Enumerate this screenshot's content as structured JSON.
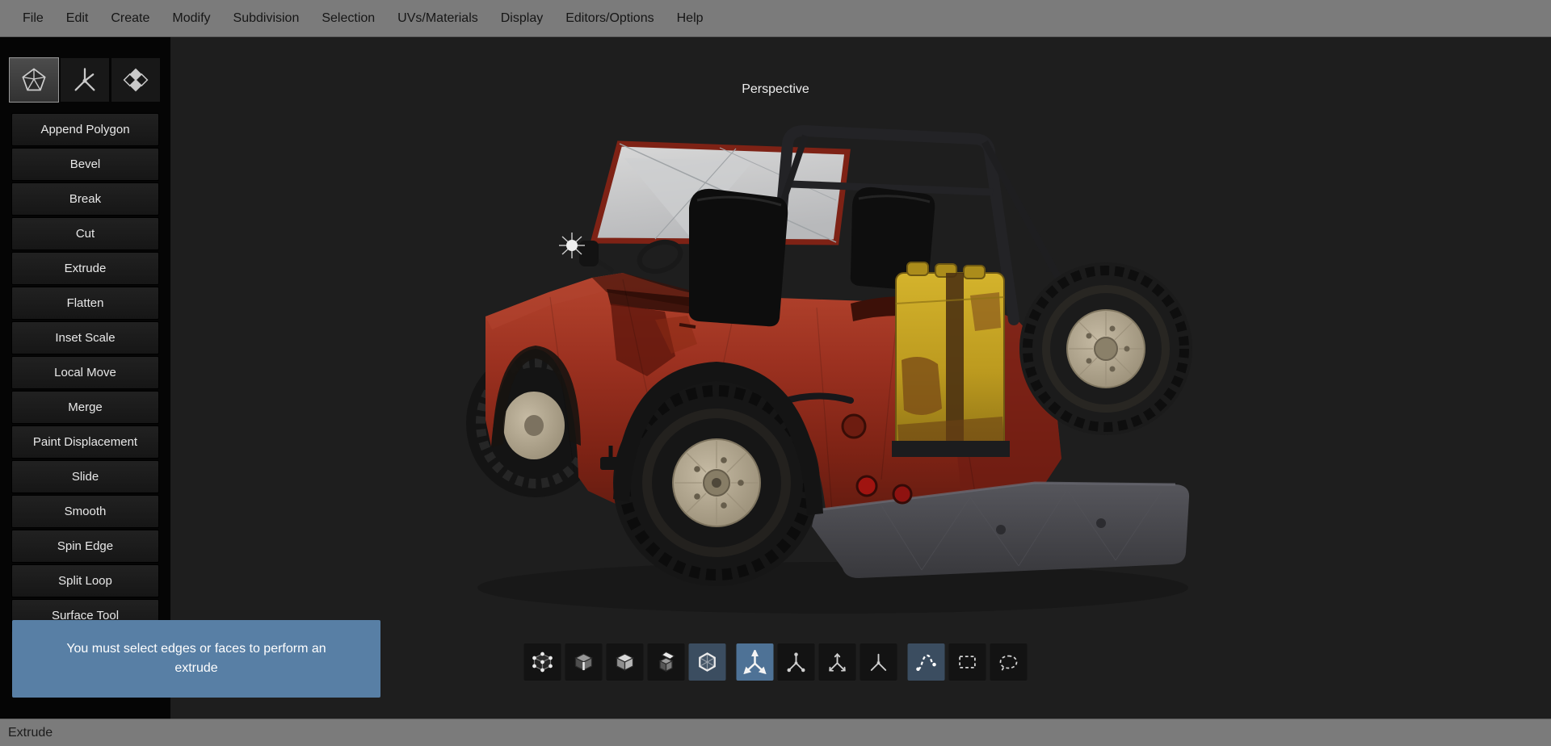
{
  "colors": {
    "menu_bar_bg": "#7b7b7b",
    "viewport_bg": "#1e1e1e",
    "panel_bg": "#050505",
    "tool_button_bg": "#1b1b1b",
    "notification_bg": "#587fa5",
    "selected_tool_bg": "#4e7296",
    "status_bar_bg": "#7b7b7b",
    "jeep_body_red": "#9c3120",
    "jerry_can_yellow": "#c2a11e"
  },
  "menu_bar": {
    "items": [
      "File",
      "Edit",
      "Create",
      "Modify",
      "Subdivision",
      "Selection",
      "UVs/Materials",
      "Display",
      "Editors/Options",
      "Help"
    ]
  },
  "left_panel": {
    "mode_tabs": [
      {
        "name": "polygon-tools-tab",
        "icon": "wireframe-gem-icon",
        "selected": true
      },
      {
        "name": "topology-tools-tab",
        "icon": "axis-star-icon",
        "selected": false
      },
      {
        "name": "uv-tools-tab",
        "icon": "checker-diamond-icon",
        "selected": false
      }
    ],
    "tools": [
      "Append Polygon",
      "Bevel",
      "Break",
      "Cut",
      "Extrude",
      "Flatten",
      "Inset Scale",
      "Local Move",
      "Merge",
      "Paint Displacement",
      "Slide",
      "Smooth",
      "Spin Edge",
      "Split Loop",
      "Surface Tool"
    ]
  },
  "notification": {
    "message": "You must select edges or faces to perform an extrude"
  },
  "viewport": {
    "label": "Perspective"
  },
  "bottom_toolbar": {
    "groups": [
      {
        "icons": [
          {
            "name": "vertex-select-mode",
            "selected": false
          },
          {
            "name": "edge-select-mode",
            "selected": false
          },
          {
            "name": "face-select-mode",
            "selected": false
          },
          {
            "name": "object-select-mode",
            "selected": false
          },
          {
            "name": "polygon-select-mode",
            "selected": true
          }
        ]
      },
      {
        "icons": [
          {
            "name": "move-tool",
            "selected": true
          },
          {
            "name": "axis-dots-tool",
            "selected": false
          },
          {
            "name": "axis-arrows-tool",
            "selected": false
          },
          {
            "name": "axis-pivot-tool",
            "selected": false
          }
        ]
      },
      {
        "icons": [
          {
            "name": "soft-selection-tool",
            "selected": true
          },
          {
            "name": "rectangle-select-tool",
            "selected": false
          },
          {
            "name": "lasso-select-tool",
            "selected": false
          }
        ]
      }
    ]
  },
  "status_bar": {
    "text": "Extrude"
  }
}
